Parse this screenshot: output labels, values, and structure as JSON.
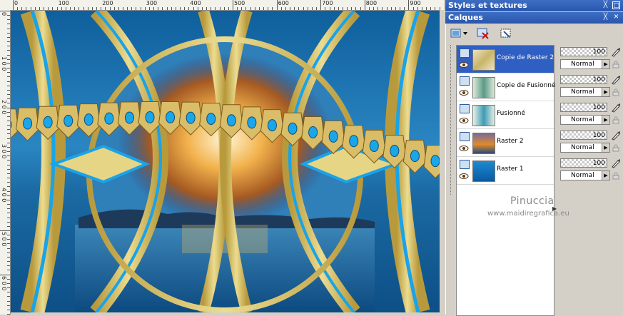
{
  "ruler": {
    "top_labels": [
      "0",
      "100",
      "200",
      "300",
      "400",
      "500",
      "600",
      "700",
      "800",
      "900"
    ],
    "left_labels": [
      "0",
      "1\n0\n0",
      "2\n0\n0",
      "3\n0\n0",
      "4\n0\n0",
      "5\n0\n0",
      "6\n0\n0",
      "7\n0\n0"
    ]
  },
  "panels": {
    "styles_title": "Styles et textures",
    "layers_title": "Calques"
  },
  "layers": [
    {
      "name": "Copie de Raster 2",
      "opacity": "100",
      "blend": "Normal",
      "selected": true
    },
    {
      "name": "Copie de Fusionné",
      "opacity": "100",
      "blend": "Normal",
      "selected": false
    },
    {
      "name": "Fusionné",
      "opacity": "100",
      "blend": "Normal",
      "selected": false
    },
    {
      "name": "Raster 2",
      "opacity": "100",
      "blend": "Normal",
      "selected": false
    },
    {
      "name": "Raster 1",
      "opacity": "100",
      "blend": "Normal",
      "selected": false
    }
  ],
  "watermark": {
    "line1": "Pinuccia",
    "line2": "www.maidiregrafica.eu"
  },
  "icons": {
    "pin": "pin-icon",
    "close": "close-panel-icon",
    "new_layer": "new-layer-icon",
    "delete_layer": "delete-layer-icon",
    "mask": "mask-icon",
    "visibility": "eye-icon",
    "edit": "brush-icon",
    "lock": "lock-icon"
  },
  "colors": {
    "titlebar": "#2a56ad",
    "selection": "#2f5fc2",
    "canvas_blue": "#1a6fa8",
    "gold": "#e2cf7a"
  }
}
